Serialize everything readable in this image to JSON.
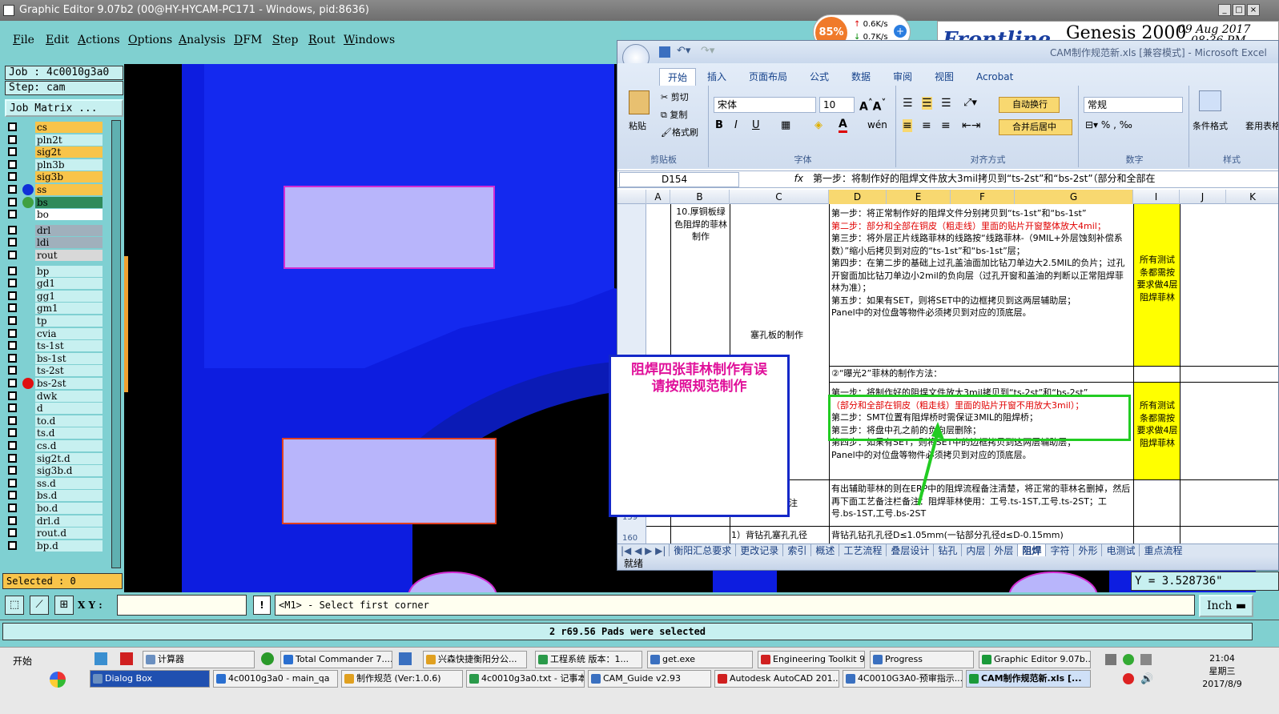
{
  "window": {
    "title": "Graphic Editor 9.07b2 (00@HY-HYCAM-PC171 - Windows, pid:8636)"
  },
  "menu": [
    "File",
    "Edit",
    "Actions",
    "Options",
    "Analysis",
    "DFM",
    "Step",
    "Rout",
    "Windows"
  ],
  "netmeter": {
    "percent": "85%",
    "up": "0.6K/s",
    "down": "0.7K/s"
  },
  "genesis": {
    "brand": "Frontline",
    "product": "Genesis 2000",
    "date": "09 Aug 2017",
    "time": "08:36 PM"
  },
  "job": {
    "job_label": "Job : 4c0010g3a0",
    "step_label": "Step: cam",
    "matrix_button": "Job Matrix ..."
  },
  "layers": [
    {
      "name": "cs",
      "color": "#f8c44a",
      "dot": ""
    },
    {
      "name": "pln2t",
      "color": "#c7f0f0",
      "dot": ""
    },
    {
      "name": "sig2t",
      "color": "#f8c44a",
      "dot": ""
    },
    {
      "name": "pln3b",
      "color": "#c7f0f0",
      "dot": ""
    },
    {
      "name": "sig3b",
      "color": "#f8c44a",
      "dot": ""
    },
    {
      "name": "ss",
      "color": "#f8c44a",
      "dot": "#1030d8"
    },
    {
      "name": "bs",
      "color": "#2f8a5a",
      "dot": "#40a040"
    },
    {
      "name": "bo",
      "color": "#ffffff",
      "dot": ""
    },
    {
      "name": "drl",
      "color": "#a0b0bc",
      "dot": ""
    },
    {
      "name": "ldi",
      "color": "#a0b0bc",
      "dot": ""
    },
    {
      "name": "rout",
      "color": "#d8d8d8",
      "dot": ""
    },
    {
      "name": "bp",
      "color": "#c7f0f0",
      "dot": ""
    },
    {
      "name": "gd1",
      "color": "#c7f0f0",
      "dot": ""
    },
    {
      "name": "gg1",
      "color": "#c7f0f0",
      "dot": ""
    },
    {
      "name": "gm1",
      "color": "#c7f0f0",
      "dot": ""
    },
    {
      "name": "tp",
      "color": "#c7f0f0",
      "dot": ""
    },
    {
      "name": "cvia",
      "color": "#c7f0f0",
      "dot": ""
    },
    {
      "name": "ts-1st",
      "color": "#c7f0f0",
      "dot": ""
    },
    {
      "name": "bs-1st",
      "color": "#c7f0f0",
      "dot": ""
    },
    {
      "name": "ts-2st",
      "color": "#c7f0f0",
      "dot": ""
    },
    {
      "name": "bs-2st",
      "color": "#c7f0f0",
      "dot": "#e01010"
    },
    {
      "name": "dwk",
      "color": "#c7f0f0",
      "dot": ""
    },
    {
      "name": "d",
      "color": "#c7f0f0",
      "dot": ""
    },
    {
      "name": "to.d",
      "color": "#c7f0f0",
      "dot": ""
    },
    {
      "name": "ts.d",
      "color": "#c7f0f0",
      "dot": ""
    },
    {
      "name": "cs.d",
      "color": "#c7f0f0",
      "dot": ""
    },
    {
      "name": "sig2t.d",
      "color": "#c7f0f0",
      "dot": ""
    },
    {
      "name": "sig3b.d",
      "color": "#c7f0f0",
      "dot": ""
    },
    {
      "name": "ss.d",
      "color": "#c7f0f0",
      "dot": ""
    },
    {
      "name": "bs.d",
      "color": "#c7f0f0",
      "dot": ""
    },
    {
      "name": "bo.d",
      "color": "#c7f0f0",
      "dot": ""
    },
    {
      "name": "drl.d",
      "color": "#c7f0f0",
      "dot": ""
    },
    {
      "name": "rout.d",
      "color": "#c7f0f0",
      "dot": ""
    },
    {
      "name": "bp.d",
      "color": "#c7f0f0",
      "dot": ""
    }
  ],
  "selected_label": "Selected : 0",
  "coords": {
    "y_readout": "Y = 3.528736\"",
    "xy_label": "X Y :",
    "xy_value": "",
    "units": "Inch"
  },
  "prompt": "<M1> - Select first corner",
  "status_message": "2 r69.56 Pads were selected",
  "annotation": {
    "line1": "阻焊四张菲林制作有误",
    "line2": "请按照规范制作"
  },
  "excel": {
    "title": "CAM制作规范新.xls [兼容模式] - Microsoft Excel",
    "tabs": [
      "开始",
      "插入",
      "页面布局",
      "公式",
      "数据",
      "审阅",
      "视图",
      "Acrobat"
    ],
    "clipboard": {
      "paste": "粘贴",
      "cut": "剪切",
      "copy": "复制",
      "format_painter": "格式刷",
      "label": "剪贴板"
    },
    "font": {
      "name": "宋体",
      "size": "10",
      "label": "字体"
    },
    "align": {
      "wrap": "自动换行",
      "merge": "合并后居中",
      "label": "对齐方式"
    },
    "number": {
      "format": "常规",
      "label": "数字"
    },
    "styles": {
      "conditional": "条件格式",
      "table": "套用表格格式",
      "label": "样式"
    },
    "namebox": "D154",
    "formula": "第一步：将制作好的阻焊文件放大3mil拷贝到“ts-2st”和“bs-2st”（部分和全部在",
    "columns": [
      "A",
      "B",
      "C",
      "D",
      "E",
      "F",
      "G",
      "I",
      "J",
      "K"
    ],
    "row_numbers": [
      "159",
      "160"
    ],
    "cells": {
      "b_heading": "10.厚铜板绿色阻焊的菲林制作",
      "c_heading": "塞孔板的制作",
      "d_steps_1": "第一步：将正常制作好的阻焊文件分别拷贝到“ts-1st”和“bs-1st”",
      "d_steps_2": "第二步：部分和全部在铜皮（粗走线）里面的贴片开窗整体放大4mil；",
      "d_steps_3": "第三步：将外层正片线路菲林的线路按“线路菲林-（9MIL+外层蚀刻补偿系数）”缩小后拷贝到对应的“ts-1st”和“bs-1st”层；",
      "d_steps_4": "第四步：在第二步的基础上过孔盖油面加比钻刀单边大2.5MIL的负片；过孔开窗面加比钻刀单边小2mil的负向层（过孔开窗和盖油的判断以正常阻焊菲林为准）；",
      "d_steps_5": "第五步：如果有SET，则将SET中的边框拷贝到这两层辅助层；",
      "d_steps_6": "Panel中的对位盘等物件必须拷贝到对应的顶底层。",
      "i_note_1": "所有测试条都需按要求做4层阻焊菲林",
      "d_exposure2": "②“曝光2”菲林的制作方法：",
      "d_s2_1a": "第一步：将制作好的阻焊文件放大3mil拷贝到“ts-2st”和“bs-2st”",
      "d_s2_1b": "（部分和全部在铜皮（粗走线）里面的贴片开窗不用放大3mil）；",
      "d_s2_2": "第二步：SMT位置有阻焊桥时需保证3MIL的阻焊桥；",
      "d_s2_3": "第三步：将盘中孔之前的负向层删除；",
      "d_s2_4": "第四步：如果有SET，则将SET中的边框拷贝到这两层辅助层；",
      "d_s2_5": "Panel中的对位盘等物件必须拷贝到对应的顶底层。",
      "i_note_2": "所有测试条都需按要求做4层阻焊菲林",
      "d_erp": "有出辅助菲林的则在ERP中的阻焊流程备注清楚，将正常的菲林名删掉，然后再下面工艺备注栏备注：阻焊菲林使用：工号.ts-1ST,工号.ts-2ST；工号.bs-1ST,工号.bs-2ST",
      "c_note_tail": "注",
      "c_back_drill": "1）背钻孔塞孔孔径",
      "d_back_drill": "背钻孔钻孔孔径D≤1.05mm(一钻部分孔径d≤D-0.15mm)"
    },
    "sheets": [
      "衡阳汇总要求",
      "更改记录",
      "索引",
      "概述",
      "工艺流程",
      "叠层设计",
      "钻孔",
      "内层",
      "外层",
      "阻焊",
      "字符",
      "外形",
      "电测试",
      "重点流程"
    ],
    "status": "就绪",
    "colors": {
      "highlight_yellow": "#ffff00",
      "red_text": "#e00000",
      "green_box": "#22cc22"
    }
  },
  "taskbar": {
    "start": "开始",
    "row1": [
      "计算器",
      "Total Commander 7....",
      "兴森快捷衡阳分公...",
      "工程系统  版本：1...",
      "get.exe",
      "Engineering Toolkit 9...",
      "Progress",
      "Graphic Editor 9.07b..."
    ],
    "row2": [
      "Dialog Box",
      "4c0010g3a0 - main_qa",
      "制作规范 (Ver:1.0.6)",
      "4c0010g3a0.txt - 记事本",
      "CAM_Guide v2.93",
      "Autodesk AutoCAD 201...",
      "4C0010G3A0-预审指示...",
      "CAM制作规范新.xls [..."
    ],
    "clock": {
      "time": "21:04",
      "weekday": "星期三",
      "date": "2017/8/9"
    }
  }
}
